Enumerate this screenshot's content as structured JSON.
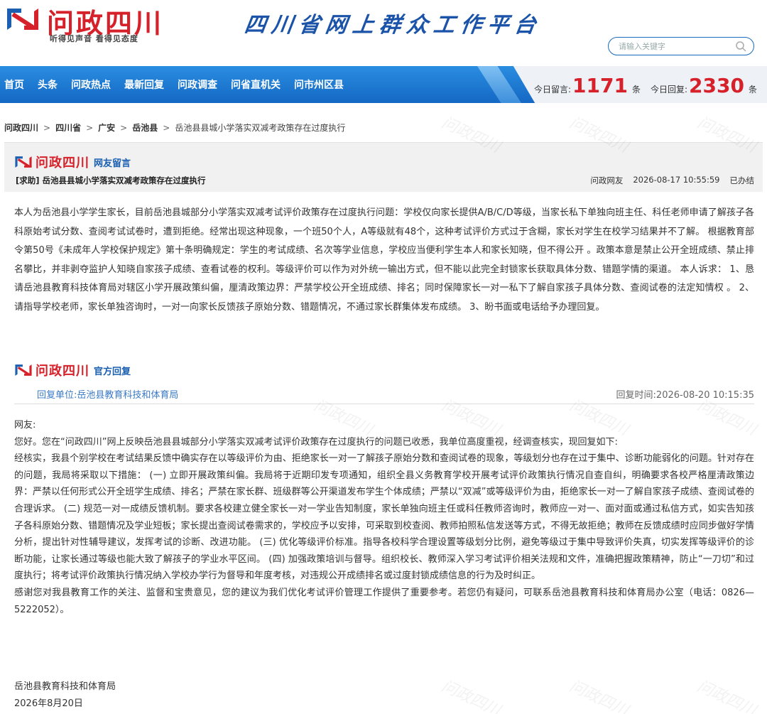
{
  "header": {
    "logo_text": "问政四川",
    "slogan": "听得见声音  看得见态度",
    "platform_title": "四川省网上群众工作平台",
    "search_placeholder": "请输入关键字"
  },
  "nav": {
    "items": [
      "首页",
      "头条",
      "问政热点",
      "最新回复",
      "问政调查",
      "问省直机关",
      "问市州区县"
    ]
  },
  "stats": {
    "today_messages_label": "今日留言:",
    "today_messages": "1171",
    "today_messages_unit": "条",
    "today_replies_label": "今日回复:",
    "today_replies": "2330",
    "today_replies_unit": "条"
  },
  "breadcrumb": [
    "问政四川",
    "四川省",
    "广安",
    "岳池县",
    "岳池县县城小学落实双减考政策存在过度执行"
  ],
  "message": {
    "brand": "问政四川",
    "section_tag": "网友留言",
    "title": "[求助] 岳池县县城小学落实双减考政策存在过度执行",
    "author": "问政网友",
    "datetime": "2026-08-17 10:55:59",
    "status": "已办结",
    "body": "本人为岳池县小学学生家长，目前岳池县城部分小学落实双减考试评价政策存在过度执行问题：学校仅向家长提供A/B/C/D等级，当家长私下单独向班主任、科任老师申请了解孩子各科原始考试分数、查阅考试试卷时，遭到拒绝。经常出现这种现象，一个班50个人，A等级就有48个，这种考试评价方式过于含糊，家长对学生在校学习结果并不了解。 根据教育部令第50号《未成年人学校保护规定》第十条明确规定：学生的考试成绩、名次等学业信息，学校应当便利学生本人和家长知晓，但不得公开 。政策本意是禁止公开全班成绩、禁止排名攀比，并非剥夺监护人知晓自家孩子成绩、查看试卷的权利。等级评价可以作为对外统一输出方式，但不能以此完全封锁家长获取具体分数、错题学情的渠道。 本人诉求： 1、恳请岳池县教育科技体育局对辖区小学开展政策纠偏，厘清政策边界：严禁学校公开全班成绩、排名；同时保障家长一对一私下了解自家孩子具体分数、查阅试卷的法定知情权 。 2、请指导学校老师，家长单独咨询时，一对一向家长反馈孩子原始分数、错题情况，不通过家长群集体发布成绩。 3、盼书面或电话给予办理回复。"
  },
  "reply": {
    "brand": "问政四川",
    "section_tag": "官方回复",
    "unit_label": "回复单位:",
    "unit": "岳池县教育科技和体育局",
    "time_label": "回复时间:",
    "time": "2026-08-20 10:15:35",
    "paragraphs": [
      "网友:",
      "您好。您在“问政四川”网上反映岳池县县城部分小学落实双减考试评价政策存在过度执行的问题已收悉，我单位高度重视，经调查核实，现回复如下:",
      "经核实，我县个别学校在考试结果反馈中确实存在以等级评价为由、拒绝家长一对一了解孩子原始分数和查阅试卷的现象，等级划分也存在过于集中、诊断功能弱化的问题。针对存在的问题，我局将采取以下措施： (一) 立即开展政策纠偏。我局将于近期印发专项通知，组织全县义务教育学校开展考试评价政策执行情况自查自纠，明确要求各校严格厘清政策边界：严禁以任何形式公开全班学生成绩、排名；严禁在家长群、班级群等公开渠道发布学生个体成绩；严禁以“双减”或等级评价为由，拒绝家长一对一了解自家孩子成绩、查阅试卷的合理诉求。 (二) 规范一对一成绩反馈机制。要求各校建立健全家长一对一学业告知制度，家长单独向班主任或科任教师咨询时，教师应一对一、面对面或通过私信方式，如实告知孩子各科原始分数、错题情况及学业短板；家长提出查阅试卷需求的，学校应予以安排，可采取到校查阅、教师拍照私信发送等方式，不得无故拒绝；教师在反馈成绩时应同步做好学情分析，提出针对性辅导建议，发挥考试的诊断、改进功能。 (三) 优化等级评价标准。指导各校科学合理设置等级划分比例，避免等级过于集中导致评价失真，切实发挥等级评价的诊断功能，让家长通过等级也能大致了解孩子的学业水平区间。 (四) 加强政策培训与督导。组织校长、教师深入学习考试评价相关法规和文件，准确把握政策精神，防止“一刀切”和过度执行；将考试评价政策执行情况纳入学校办学行为督导和年度考核，对违规公开成绩排名或过度封锁成绩信息的行为及时纠正。",
      "感谢您对我县教育工作的关注、监督和宝贵意见，您的建议为我们优化考试评价管理工作提供了重要参考。若您仍有疑问，可联系岳池县教育科技和体育局办公室（电话：0826—5222052）。"
    ],
    "signature": "岳池县教育科技和体育局",
    "sign_date": "2026年8月20日"
  },
  "watermark_text": "问政四川",
  "colors": {
    "brand_red": "#d6202a",
    "nav_blue": "#1b72cc",
    "link_blue": "#3a7ac4"
  }
}
